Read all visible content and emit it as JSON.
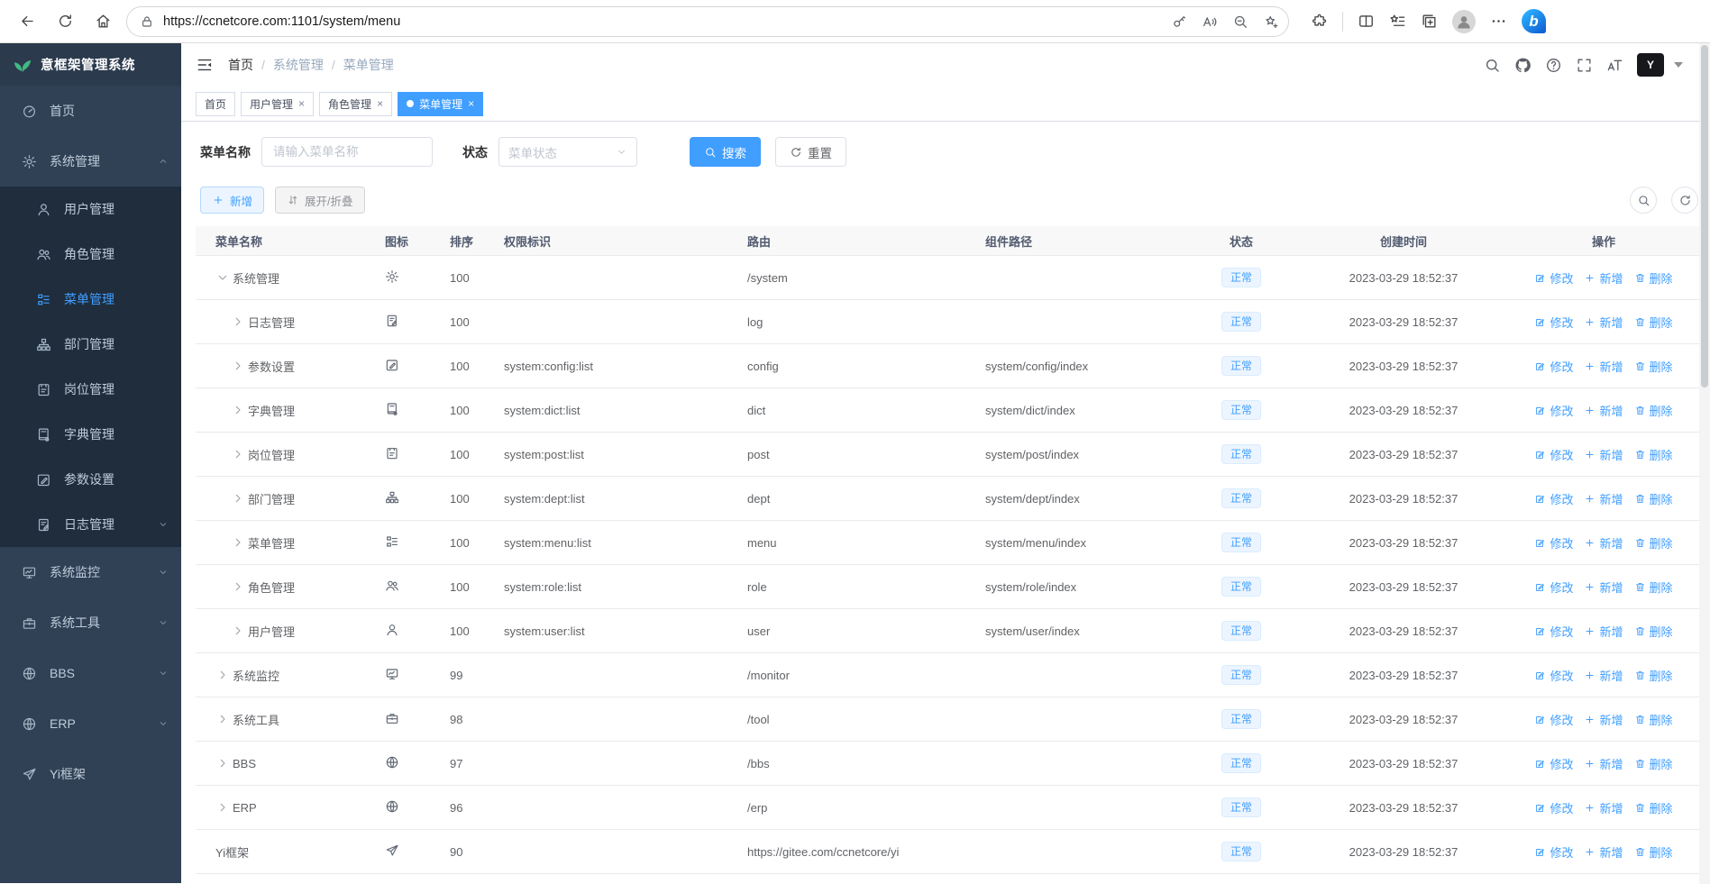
{
  "colors": {
    "accent": "#409eff",
    "sidebar_bg": "#304156",
    "submenu_bg": "#1f2d3d",
    "status_text": "#409eff",
    "status_bg": "#ecf5ff",
    "active_text": "#bfcbd9"
  },
  "browser": {
    "url": "https://ccnetcore.com:1101/system/menu"
  },
  "app": {
    "logo_title": "意框架管理系统",
    "breadcrumb": {
      "items": [
        "首页",
        "系统管理",
        "菜单管理"
      ],
      "separator": "/"
    },
    "sidebar": {
      "items": [
        {
          "label": "首页",
          "icon": "dashboard",
          "sub": false,
          "active": false,
          "arrow": ""
        },
        {
          "label": "系统管理",
          "icon": "gear",
          "sub": false,
          "active": false,
          "arrow": "up"
        },
        {
          "label": "用户管理",
          "icon": "user",
          "sub": true,
          "active": false,
          "arrow": ""
        },
        {
          "label": "角色管理",
          "icon": "users",
          "sub": true,
          "active": false,
          "arrow": ""
        },
        {
          "label": "菜单管理",
          "icon": "menu-list",
          "sub": true,
          "active": true,
          "arrow": ""
        },
        {
          "label": "部门管理",
          "icon": "org-tree",
          "sub": true,
          "active": false,
          "arrow": ""
        },
        {
          "label": "岗位管理",
          "icon": "id-card",
          "sub": true,
          "active": false,
          "arrow": ""
        },
        {
          "label": "字典管理",
          "icon": "book",
          "sub": true,
          "active": false,
          "arrow": ""
        },
        {
          "label": "参数设置",
          "icon": "pen-square",
          "sub": true,
          "active": false,
          "arrow": ""
        },
        {
          "label": "日志管理",
          "icon": "doc-edit",
          "sub": true,
          "active": false,
          "arrow": "down"
        },
        {
          "label": "系统监控",
          "icon": "monitor",
          "sub": false,
          "active": false,
          "arrow": "down"
        },
        {
          "label": "系统工具",
          "icon": "toolbox",
          "sub": false,
          "active": false,
          "arrow": "down"
        },
        {
          "label": "BBS",
          "icon": "globe",
          "sub": false,
          "active": false,
          "arrow": "down"
        },
        {
          "label": "ERP",
          "icon": "globe",
          "sub": false,
          "active": false,
          "arrow": "down"
        },
        {
          "label": "Yi框架",
          "icon": "paper-plane",
          "sub": false,
          "active": false,
          "arrow": ""
        }
      ]
    },
    "tabs": [
      {
        "label": "首页",
        "active": false,
        "closable": false
      },
      {
        "label": "用户管理",
        "active": false,
        "closable": true
      },
      {
        "label": "角色管理",
        "active": false,
        "closable": true
      },
      {
        "label": "菜单管理",
        "active": true,
        "closable": true
      }
    ],
    "search": {
      "name_label": "菜单名称",
      "name_placeholder": "请输入菜单名称",
      "status_label": "状态",
      "status_placeholder": "菜单状态",
      "search_btn": "搜索",
      "reset_btn": "重置"
    },
    "toolbar": {
      "add_btn": "新增",
      "expand_btn": "展开/折叠"
    },
    "table": {
      "headers": [
        "菜单名称",
        "图标",
        "排序",
        "权限标识",
        "路由",
        "组件路径",
        "状态",
        "创建时间",
        "操作"
      ],
      "ops": {
        "edit": "修改",
        "add": "新增",
        "del": "删除"
      },
      "rows": [
        {
          "name": "系统管理",
          "icon": "gear",
          "level": 0,
          "caret": "down",
          "sort": "100",
          "perm": "",
          "route": "/system",
          "component": "",
          "status": "正常",
          "time": "2023-03-29 18:52:37"
        },
        {
          "name": "日志管理",
          "icon": "doc-edit",
          "level": 1,
          "caret": "right",
          "sort": "100",
          "perm": "",
          "route": "log",
          "component": "",
          "status": "正常",
          "time": "2023-03-29 18:52:37"
        },
        {
          "name": "参数设置",
          "icon": "pen-square",
          "level": 1,
          "caret": "right",
          "sort": "100",
          "perm": "system:config:list",
          "route": "config",
          "component": "system/config/index",
          "status": "正常",
          "time": "2023-03-29 18:52:37"
        },
        {
          "name": "字典管理",
          "icon": "book",
          "level": 1,
          "caret": "right",
          "sort": "100",
          "perm": "system:dict:list",
          "route": "dict",
          "component": "system/dict/index",
          "status": "正常",
          "time": "2023-03-29 18:52:37"
        },
        {
          "name": "岗位管理",
          "icon": "id-card",
          "level": 1,
          "caret": "right",
          "sort": "100",
          "perm": "system:post:list",
          "route": "post",
          "component": "system/post/index",
          "status": "正常",
          "time": "2023-03-29 18:52:37"
        },
        {
          "name": "部门管理",
          "icon": "org-tree",
          "level": 1,
          "caret": "right",
          "sort": "100",
          "perm": "system:dept:list",
          "route": "dept",
          "component": "system/dept/index",
          "status": "正常",
          "time": "2023-03-29 18:52:37"
        },
        {
          "name": "菜单管理",
          "icon": "menu-list",
          "level": 1,
          "caret": "right",
          "sort": "100",
          "perm": "system:menu:list",
          "route": "menu",
          "component": "system/menu/index",
          "status": "正常",
          "time": "2023-03-29 18:52:37"
        },
        {
          "name": "角色管理",
          "icon": "users",
          "level": 1,
          "caret": "right",
          "sort": "100",
          "perm": "system:role:list",
          "route": "role",
          "component": "system/role/index",
          "status": "正常",
          "time": "2023-03-29 18:52:37"
        },
        {
          "name": "用户管理",
          "icon": "user",
          "level": 1,
          "caret": "right",
          "sort": "100",
          "perm": "system:user:list",
          "route": "user",
          "component": "system/user/index",
          "status": "正常",
          "time": "2023-03-29 18:52:37"
        },
        {
          "name": "系统监控",
          "icon": "monitor",
          "level": 0,
          "caret": "right",
          "sort": "99",
          "perm": "",
          "route": "/monitor",
          "component": "",
          "status": "正常",
          "time": "2023-03-29 18:52:37"
        },
        {
          "name": "系统工具",
          "icon": "toolbox",
          "level": 0,
          "caret": "right",
          "sort": "98",
          "perm": "",
          "route": "/tool",
          "component": "",
          "status": "正常",
          "time": "2023-03-29 18:52:37"
        },
        {
          "name": "BBS",
          "icon": "globe",
          "level": 0,
          "caret": "right",
          "sort": "97",
          "perm": "",
          "route": "/bbs",
          "component": "",
          "status": "正常",
          "time": "2023-03-29 18:52:37"
        },
        {
          "name": "ERP",
          "icon": "globe",
          "level": 0,
          "caret": "right",
          "sort": "96",
          "perm": "",
          "route": "/erp",
          "component": "",
          "status": "正常",
          "time": "2023-03-29 18:52:37"
        },
        {
          "name": "Yi框架",
          "icon": "paper-plane",
          "level": 0,
          "caret": "none",
          "sort": "90",
          "perm": "",
          "route": "https://gitee.com/ccnetcore/yi",
          "component": "",
          "status": "正常",
          "time": "2023-03-29 18:52:37"
        }
      ]
    }
  }
}
